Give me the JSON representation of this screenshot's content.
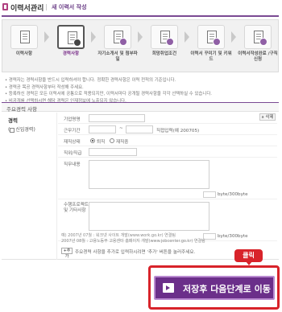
{
  "header": {
    "title": "이력서관리",
    "subtitle": "새 이력서 작성"
  },
  "steps": [
    {
      "label": "이력사항",
      "icon": "document-icon",
      "active": false
    },
    {
      "label": "경력사항",
      "icon": "document-edit-icon",
      "active": true
    },
    {
      "label": "자기소개서 및 첨부파일",
      "icon": "document-attach-icon",
      "active": false
    },
    {
      "label": "희망취업조건",
      "icon": "document-target-icon",
      "active": false
    },
    {
      "label": "이력서 꾸미기 및 키워드",
      "icon": "document-style-icon",
      "active": false
    },
    {
      "label": "이력서작성완료 /구직신청",
      "icon": "document-done-icon",
      "active": false
    }
  ],
  "notices": [
    "• 경력자는 경력사항을 반드시 입력하셔야 합니다. 정확한 경력사항은 이력 전적의 기준입니다.",
    "• 경력공 목공 경력사항부터 작성해 주세요.",
    "• 등록하신 경력은 모든 이력서에 공통으로 적용되지만, 이력서마다 공개될 경력사항을 각각 선택하실 수 있습니다.",
    "• 비공개를 선택하시면 해당 경력은 인재정보에 노출되지 않습니다."
  ],
  "section": {
    "title": "주요경력 사항",
    "career_label": "경력",
    "newbie_label": "신입경력"
  },
  "form": {
    "company_label": "기업명명",
    "period_label": "근무기간",
    "period_sep": "~",
    "direct_input": "직접입력(예 200705)",
    "status_label": "재직상태",
    "status_options": [
      "퇴직",
      "재직중"
    ],
    "title_label": "직위/직급",
    "duty_label": "직무내용",
    "byte_limit_1": "byte/300byte",
    "achievement_label": "수행프로젝트 및 기타사항",
    "byte_limit_2": "byte/300byte",
    "delete_label": "x 삭제"
  },
  "info_lines": [
    "예) 2007년 07월 : 워크넷 사이트 개발(www.work.go.kr) 연결팀",
    "2007년 08월 : 고용노동부 고용센터 홈페이지 개발(www.jobcenter.go.kr) 연결팀"
  ],
  "add": {
    "button": "+추가",
    "text": "주요경력 사항을 추가로 입력하시려면 '추가' 버튼을 눌러주세요."
  },
  "callout": "클릭",
  "save_button": "저장후 다음단계로 이동"
}
